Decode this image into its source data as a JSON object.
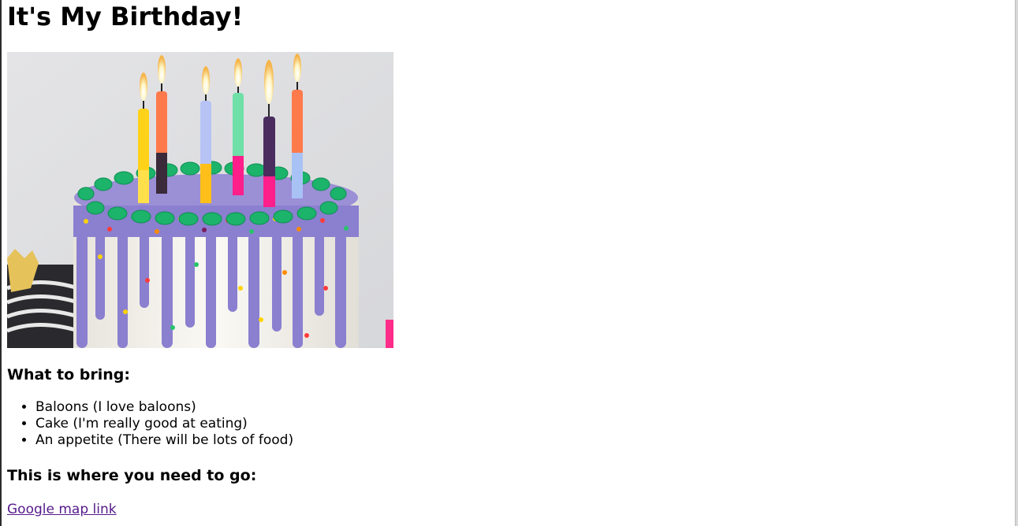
{
  "page": {
    "title": "It's My Birthday!",
    "image": {
      "alt": "",
      "icon": "birthday-cake-image"
    },
    "bring_heading": "What to bring:",
    "bring_items": [
      "Baloons (I love baloons)",
      "Cake (I'm really good at eating)",
      "An appetite (There will be lots of food)"
    ],
    "go_heading": "This is where you need to go:",
    "map_link": "Google map link"
  },
  "colors": {
    "link_visited": "#551a8b",
    "text": "#000000",
    "background": "#ffffff"
  }
}
